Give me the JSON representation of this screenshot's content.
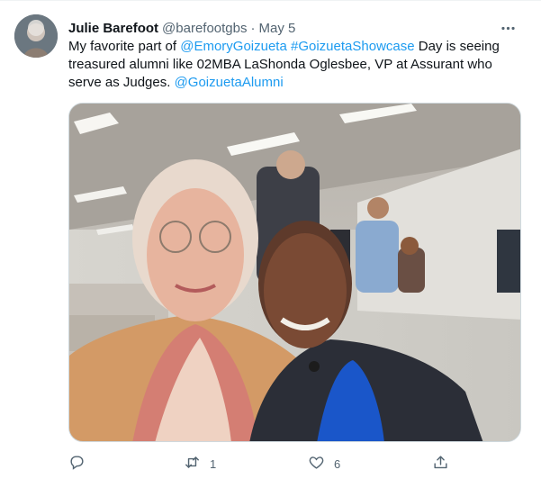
{
  "tweet": {
    "author_name": "Julie Barefoot",
    "author_handle": "@barefootgbs",
    "separator": "·",
    "date": "May 5",
    "text_parts": {
      "p1": "My favorite part of ",
      "mention1": "@EmoryGoizueta",
      "space1": " ",
      "hashtag1": "#GoizuetaShowcase",
      "p2": " Day is seeing treasured alumni like 02MBA LaShonda Oglesbee, VP at Assurant who serve as Judges.  ",
      "mention2": "@GoizuetaAlumni"
    },
    "actions": {
      "reply_count": "",
      "retweet_count": "1",
      "like_count": "6"
    },
    "icons": {
      "more": "more-horizontal-icon",
      "reply": "reply-icon",
      "retweet": "retweet-icon",
      "like": "heart-icon",
      "share": "share-icon"
    },
    "colors": {
      "link": "#1d9bf0",
      "secondary_text": "#536471",
      "primary_text": "#0f1419"
    }
  }
}
